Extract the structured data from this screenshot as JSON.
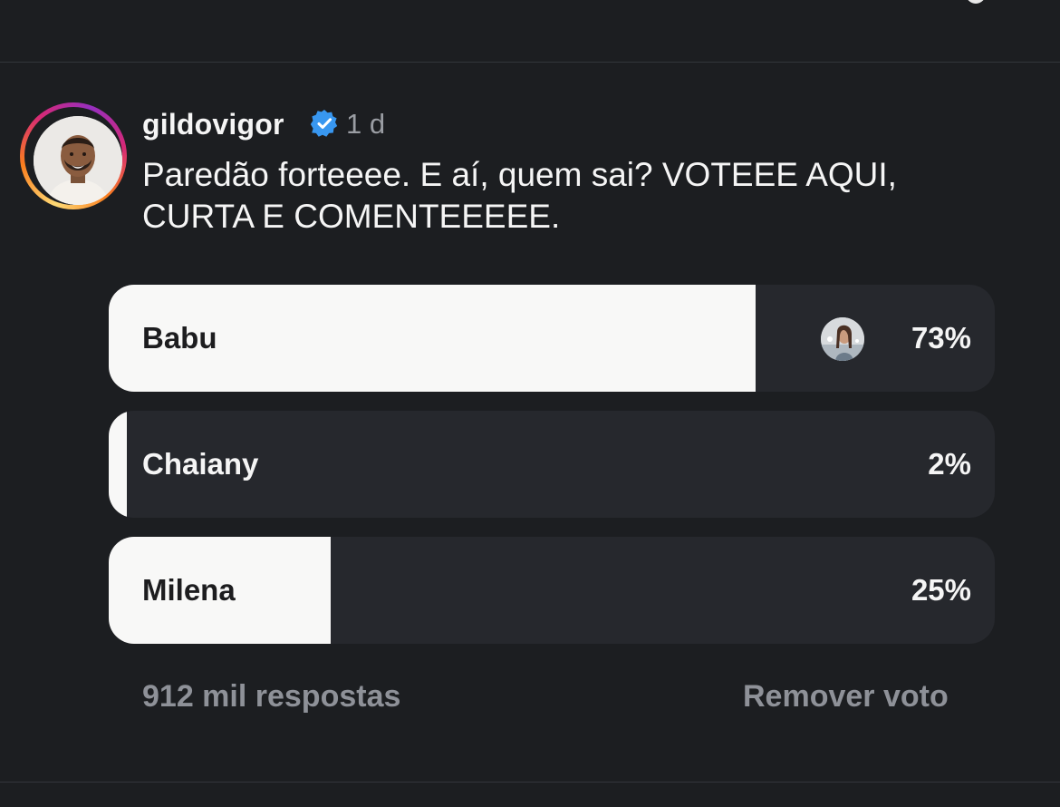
{
  "post": {
    "username": "gildovigor",
    "verified": true,
    "time": "1 d",
    "caption": "Paredão forteeee. E aí, quem sai? VOTEEE AQUI, CURTA E COMENTEEEEE."
  },
  "poll": {
    "options": [
      {
        "label": "Babu",
        "percent": 73,
        "percent_text": "73%",
        "voted": true
      },
      {
        "label": "Chaiany",
        "percent": 2,
        "percent_text": "2%",
        "voted": false
      },
      {
        "label": "Milena",
        "percent": 25,
        "percent_text": "25%",
        "voted": false
      }
    ],
    "responses": "912 mil respostas",
    "remove_vote": "Remover voto"
  },
  "colors": {
    "background": "#1c1e21",
    "bar_fill": "#f8f8f7",
    "bar_track": "#26282d",
    "muted_text": "#8e9198",
    "verified_blue": "#3897f0"
  }
}
